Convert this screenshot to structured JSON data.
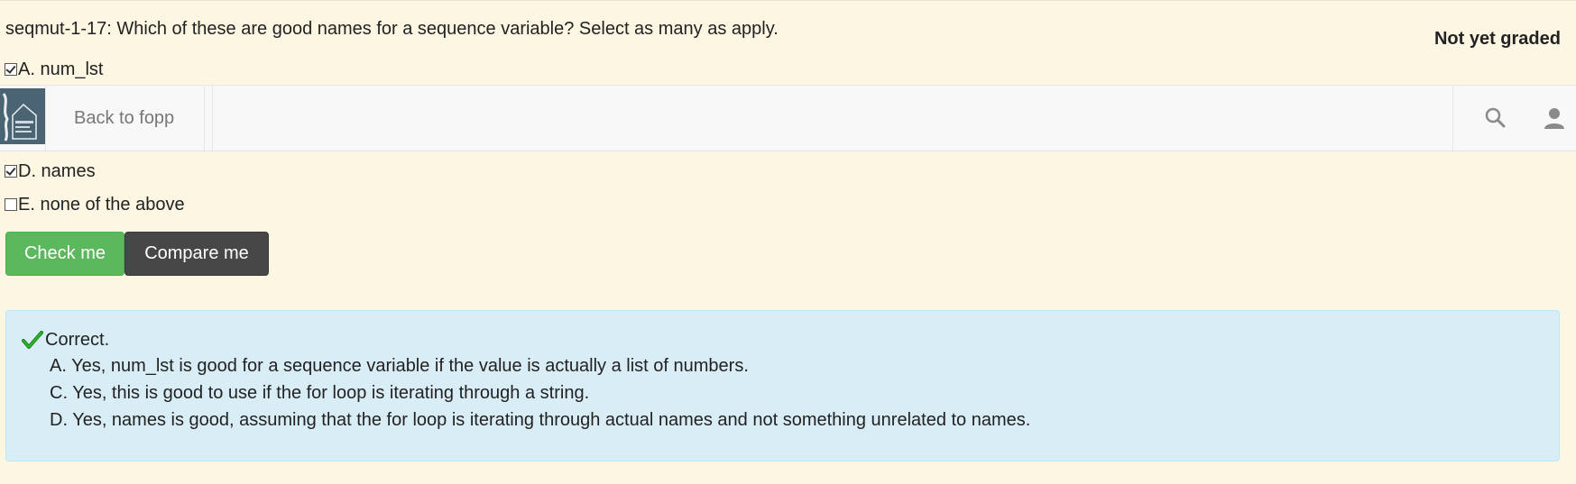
{
  "question": {
    "prompt": "seqmut-1-17: Which of these are good names for a sequence variable? Select as many as apply.",
    "grade_status": "Not yet graded",
    "options": [
      {
        "label": "A. num_lst",
        "checked": true
      },
      {
        "label": "D. names",
        "checked": true
      },
      {
        "label": "E. none of the above",
        "checked": false
      }
    ]
  },
  "navbar": {
    "back_label": "Back to fopp",
    "icons": [
      "search-icon",
      "user-icon"
    ]
  },
  "buttons": {
    "check_label": "Check me",
    "compare_label": "Compare me",
    "check_color": "#5cb85c",
    "compare_color": "#474747"
  },
  "feedback": {
    "status": "Correct.",
    "lines": [
      "A. Yes, num_lst is good for a sequence variable if the value is actually a list of numbers.",
      "C. Yes, this is good to use if the for loop is iterating through a string.",
      "D. Yes, names is good, assuming that the for loop is iterating through actual names and not something unrelated to names."
    ],
    "background_color": "#d9edf7"
  }
}
